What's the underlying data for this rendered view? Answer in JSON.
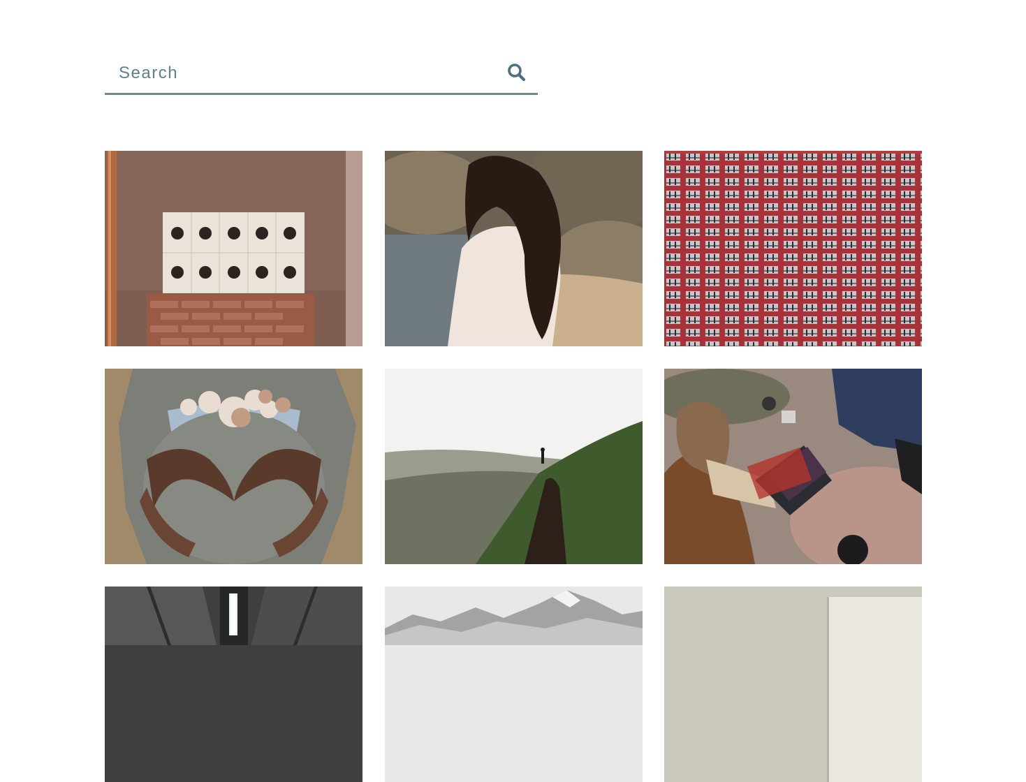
{
  "search": {
    "placeholder": "Search",
    "value": "",
    "icon": "search-icon"
  },
  "gallery": {
    "photos": [
      {
        "subject": "posters-on-brick-wall"
      },
      {
        "subject": "woman-on-beach"
      },
      {
        "subject": "red-apartment-facade"
      },
      {
        "subject": "pregnant-belly-heart-hands"
      },
      {
        "subject": "hiker-on-green-hill"
      },
      {
        "subject": "woman-with-laptop-outdoors"
      },
      {
        "subject": "tunnel-lights"
      },
      {
        "subject": "snowy-mountains"
      },
      {
        "subject": "beige-wall"
      }
    ]
  },
  "colors": {
    "accent": "#6f8a92",
    "search_text": "#5d7f93",
    "icon": "#4f6f80"
  }
}
